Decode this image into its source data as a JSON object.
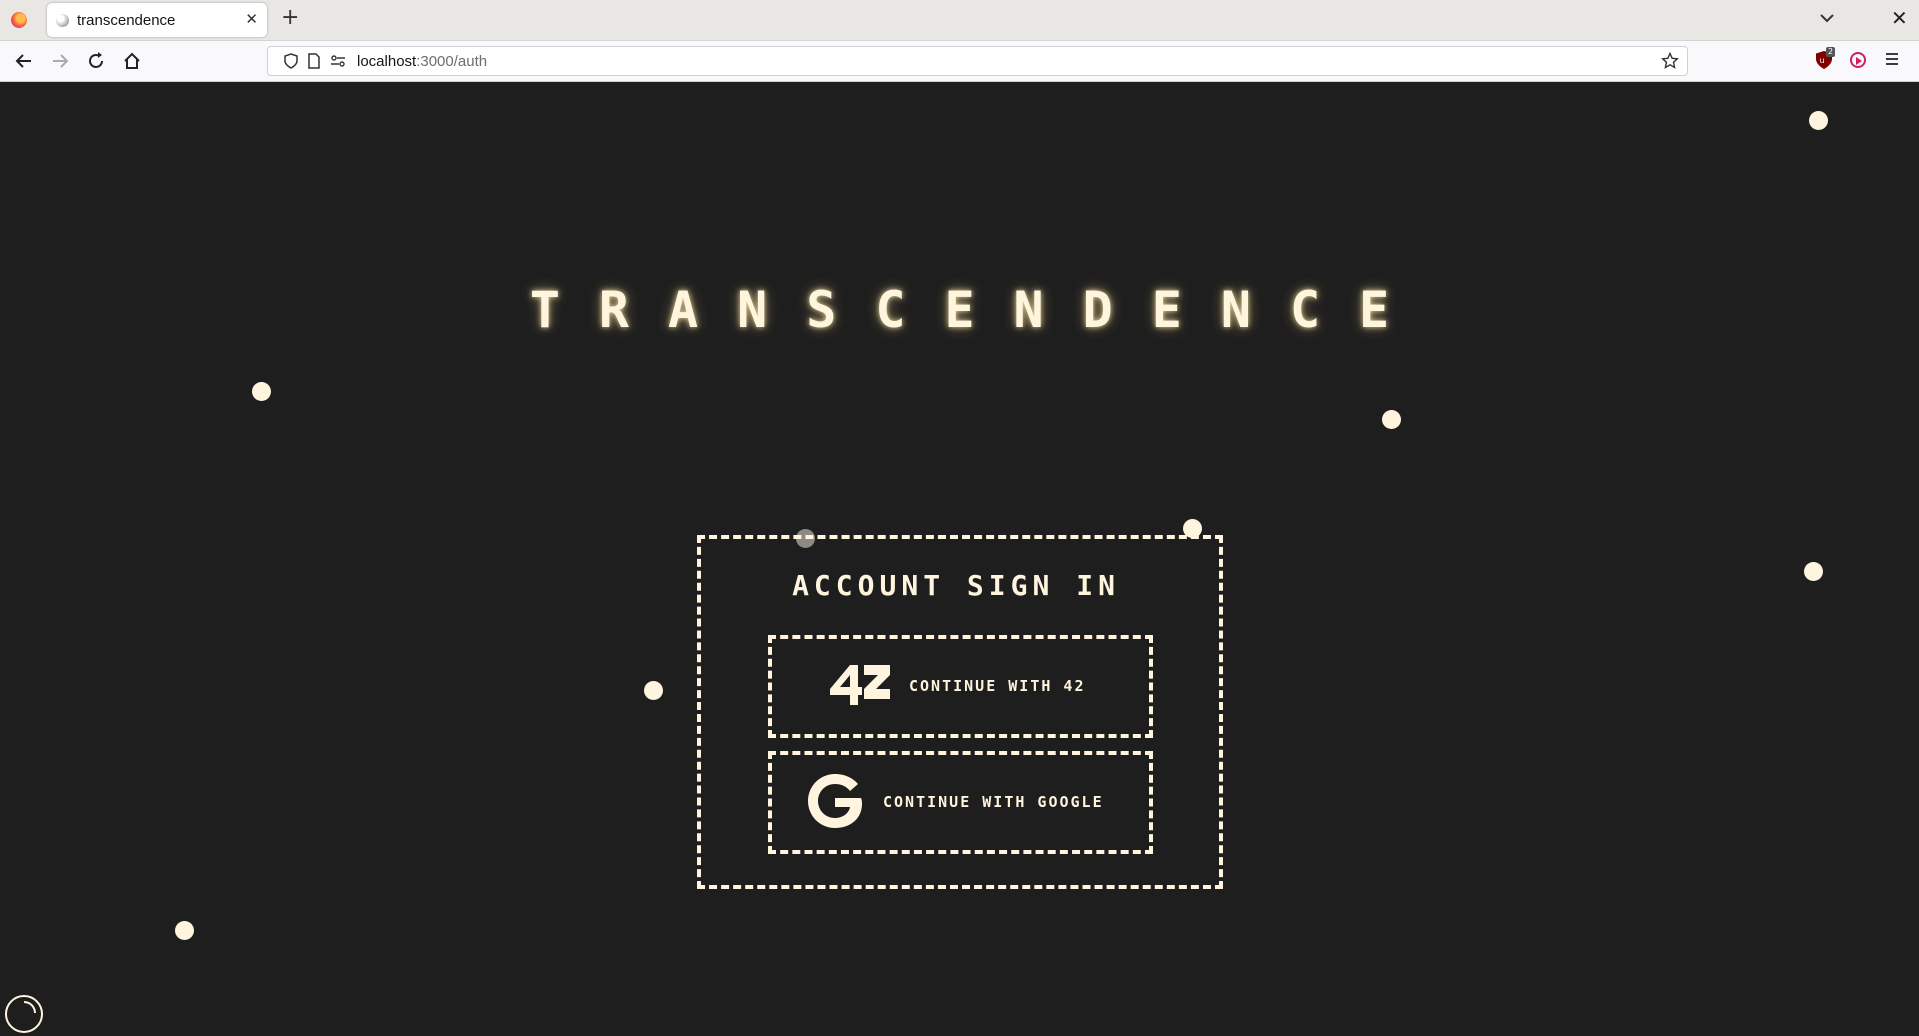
{
  "browser": {
    "tab_title": "transcendence",
    "new_tab_icon": "plus-icon",
    "url_host": "localhost",
    "url_path": ":3000/auth",
    "extension_badge": "2"
  },
  "page": {
    "title": "TRANSCENDENCE",
    "signin_heading": "ACCOUNT SIGN IN",
    "button_42_label": "CONTINUE WITH 42",
    "button_google_label": "CONTINUE WITH GOOGLE"
  },
  "colors": {
    "background": "#1e1e1e",
    "accent": "#fff4de"
  }
}
